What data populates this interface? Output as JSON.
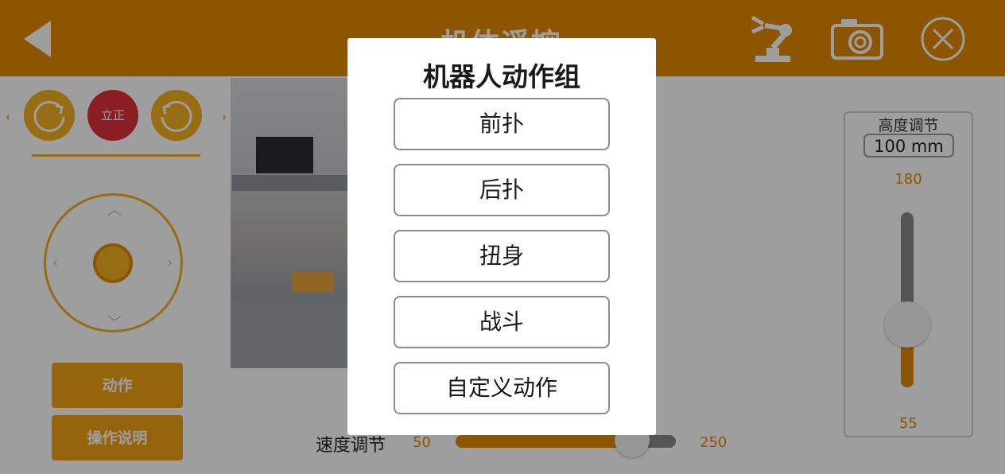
{
  "header": {
    "title": "机体遥控",
    "icons": [
      "back-arrow-icon",
      "robot-arm-icon",
      "camera-icon",
      "close-icon"
    ]
  },
  "rotate_panel": {
    "stand_label": "立正",
    "icons": [
      "rotate-left-icon",
      "rotate-right-icon"
    ]
  },
  "sidebar": {
    "action_label": "动作",
    "help_label": "操作说明"
  },
  "speed": {
    "label": "速度调节",
    "min": "50",
    "max": "250",
    "value_fraction": 0.8
  },
  "height": {
    "title": "高度调节",
    "value": "100 mm",
    "max": "180",
    "min": "55",
    "value_fraction": 0.36
  },
  "dialog": {
    "title": "机器人动作组",
    "actions": [
      "前扑",
      "后扑",
      "扭身",
      "战斗",
      "自定义动作"
    ]
  },
  "colors": {
    "accent": "#e48a00",
    "accent_light": "#f3b020",
    "stand_red": "#e0303a",
    "overlay": "rgba(0,0,0,0.38)"
  }
}
